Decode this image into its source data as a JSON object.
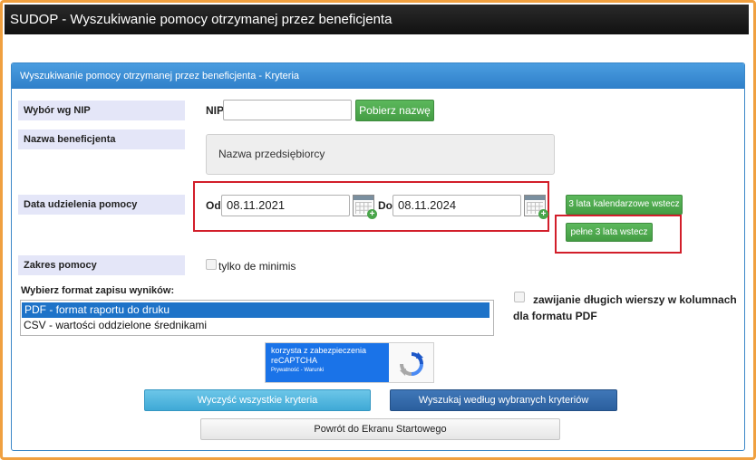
{
  "window": {
    "title": "SUDOP - Wyszukiwanie pomocy otrzymanej przez beneficjenta"
  },
  "panel": {
    "title": "Wyszukiwanie pomocy otrzymanej przez beneficjenta - Kryteria"
  },
  "nip_section": {
    "label": "Wybór wg NIP",
    "field_label": "NIP",
    "value": "",
    "button": "Pobierz nazwę"
  },
  "beneficiary": {
    "label": "Nazwa beneficjenta",
    "value": "Nazwa przedsiębiorcy"
  },
  "date_section": {
    "label": "Data udzielenia pomocy",
    "from_label": "Od",
    "from_value": "08.11.2021",
    "to_label": "Do",
    "to_value": "08.11.2024",
    "btn_calendar_years": "3 lata kalendarzowe wstecz",
    "btn_full_years": "pełne 3 lata wstecz"
  },
  "scope": {
    "label": "Zakres pomocy",
    "checkbox_label": "tylko de minimis"
  },
  "format": {
    "label": "Wybierz format zapisu wyników:",
    "options": [
      "PDF - format raportu do druku",
      "CSV - wartości oddzielone średnikami"
    ],
    "selected_index": 0,
    "wrap_label": "zawijanie długich wierszy w kolumnach dla formatu PDF"
  },
  "captcha": {
    "line1": "korzysta z zabezpieczenia",
    "line2": "reCAPTCHA",
    "line3": "Prywatność - Warunki"
  },
  "buttons": {
    "clear": "Wyczyść wszystkie kryteria",
    "search": "Wyszukaj według wybranych kryteriów",
    "back": "Powrót do Ekranu Startowego"
  },
  "colors": {
    "frame": "#f0a040",
    "highlight": "#d21e2a",
    "green_button": "#5cb85c",
    "panel_header": "#3a87c8"
  }
}
